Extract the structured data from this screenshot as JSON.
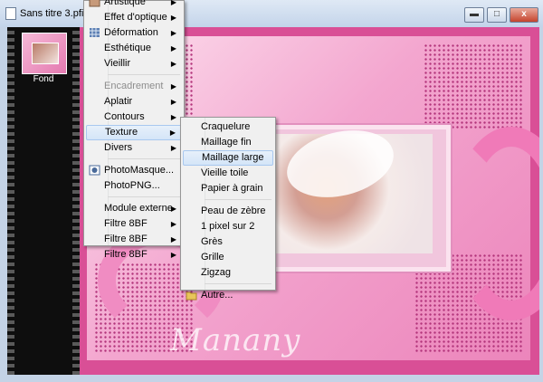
{
  "window": {
    "title": "Sans titre 3.pfi",
    "min_label": "▬",
    "max_label": "□",
    "close_label": "x"
  },
  "filmstrip": {
    "thumb_label": "Fond"
  },
  "watermark": "Manany",
  "main_menu": {
    "items": [
      {
        "label": "Artistique",
        "arrow": "▶",
        "icon": "artistique-icon"
      },
      {
        "label": "Effet d'optique",
        "arrow": "▶"
      },
      {
        "label": "Déformation",
        "arrow": "▶",
        "icon": "deformation-icon"
      },
      {
        "label": "Esthétique",
        "arrow": "▶"
      },
      {
        "label": "Vieillir",
        "arrow": "▶"
      },
      {
        "label": "Encadrement",
        "arrow": "▶",
        "disabled": true
      },
      {
        "label": "Aplatir",
        "arrow": "▶"
      },
      {
        "label": "Contours",
        "arrow": "▶"
      },
      {
        "label": "Texture",
        "arrow": "▶",
        "active": true
      },
      {
        "label": "Divers",
        "arrow": "▶"
      },
      {
        "label": "PhotoMasque...",
        "icon": "photomasque-icon"
      },
      {
        "label": "PhotoPNG..."
      },
      {
        "label": "Module externe",
        "arrow": "▶"
      },
      {
        "label": "Filtre 8BF",
        "arrow": "▶"
      },
      {
        "label": "Filtre 8BF",
        "arrow": "▶"
      },
      {
        "label": "Filtre 8BF",
        "arrow": "▶"
      }
    ]
  },
  "texture_menu": {
    "items": [
      {
        "label": "Craquelure"
      },
      {
        "label": "Maillage fin"
      },
      {
        "label": "Maillage large",
        "active": true
      },
      {
        "label": "Vieille toile"
      },
      {
        "label": "Papier à grain"
      },
      {
        "label": "Peau de zèbre"
      },
      {
        "label": "1 pixel sur 2"
      },
      {
        "label": "Grès"
      },
      {
        "label": "Grille"
      },
      {
        "label": "Zigzag"
      },
      {
        "label": "Autre...",
        "icon": "folder-icon"
      }
    ]
  }
}
